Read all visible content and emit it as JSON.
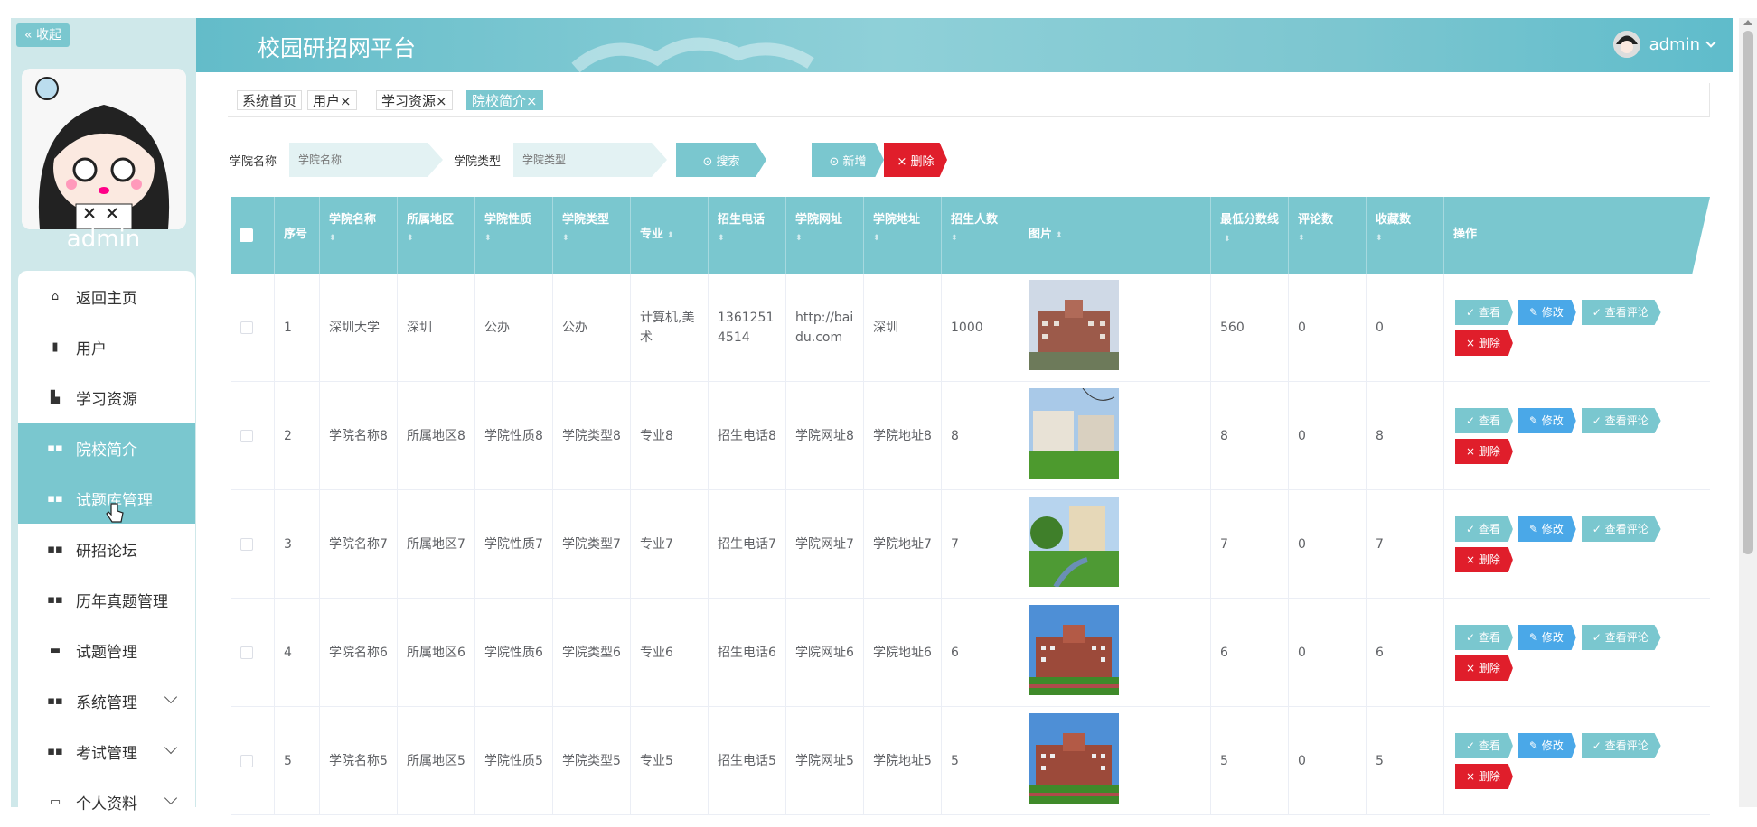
{
  "sidebar": {
    "collapse_label": "« 收起",
    "username": "admin",
    "items": [
      {
        "label": "返回主页",
        "icon": "home-icon"
      },
      {
        "label": "用户",
        "icon": "user-icon"
      },
      {
        "label": "学习资源",
        "icon": "book-icon"
      },
      {
        "label": "院校简介",
        "icon": "grid-icon",
        "active": true
      },
      {
        "label": "试题库管理",
        "icon": "grid-icon",
        "hover": true
      },
      {
        "label": "研招论坛",
        "icon": "grid-icon"
      },
      {
        "label": "历年真题管理",
        "icon": "grid-icon"
      },
      {
        "label": "试题管理",
        "icon": "file-icon"
      },
      {
        "label": "系统管理",
        "icon": "grid-icon",
        "expandable": true
      },
      {
        "label": "考试管理",
        "icon": "grid-icon",
        "expandable": true
      },
      {
        "label": "个人资料",
        "icon": "profile-icon",
        "expandable": true
      }
    ]
  },
  "header": {
    "title": "校园研招网平台",
    "user": "admin"
  },
  "tabs": [
    {
      "label": "系统首页"
    },
    {
      "label": "用户×"
    },
    {
      "label": "学习资源×"
    },
    {
      "label": "院校简介×",
      "active": true
    }
  ],
  "search": {
    "college_name_label": "学院名称",
    "college_name_placeholder": "学院名称",
    "college_type_label": "学院类型",
    "college_type_placeholder": "学院类型",
    "search_btn": "⊙ 搜索",
    "add_btn": "⊙ 新增",
    "delete_btn": "× 删除"
  },
  "table": {
    "columns": [
      "序号",
      "学院名称",
      "所属地区",
      "学院性质",
      "学院类型",
      "专业",
      "招生电话",
      "学院网址",
      "学院地址",
      "招生人数",
      "图片",
      "最低分数线",
      "评论数",
      "收藏数",
      "操作"
    ],
    "rows": [
      {
        "no": "1",
        "name": "深圳大学",
        "region": "深圳",
        "nature": "公办",
        "type": "公办",
        "major": "计算机,美术",
        "phone": "13612514514",
        "url": "http://baidu.com",
        "addr": "深圳",
        "count": "1000",
        "score": "560",
        "comments": "0",
        "favs": "0",
        "img": "building"
      },
      {
        "no": "2",
        "name": "学院名称8",
        "region": "所属地区8",
        "nature": "学院性质8",
        "type": "学院类型8",
        "major": "专业8",
        "phone": "招生电话8",
        "url": "学院网址8",
        "addr": "学院地址8",
        "count": "8",
        "score": "8",
        "comments": "0",
        "favs": "8",
        "img": "campus"
      },
      {
        "no": "3",
        "name": "学院名称7",
        "region": "所属地区7",
        "nature": "学院性质7",
        "type": "学院类型7",
        "major": "专业7",
        "phone": "招生电话7",
        "url": "学院网址7",
        "addr": "学院地址7",
        "count": "7",
        "score": "7",
        "comments": "0",
        "favs": "7",
        "img": "garden"
      },
      {
        "no": "4",
        "name": "学院名称6",
        "region": "所属地区6",
        "nature": "学院性质6",
        "type": "学院类型6",
        "major": "专业6",
        "phone": "招生电话6",
        "url": "学院网址6",
        "addr": "学院地址6",
        "count": "6",
        "score": "6",
        "comments": "0",
        "favs": "6",
        "img": "brick"
      },
      {
        "no": "5",
        "name": "学院名称5",
        "region": "所属地区5",
        "nature": "学院性质5",
        "type": "学院类型5",
        "major": "专业5",
        "phone": "招生电话5",
        "url": "学院网址5",
        "addr": "学院地址5",
        "count": "5",
        "score": "5",
        "comments": "0",
        "favs": "5",
        "img": "brick"
      }
    ],
    "ops": {
      "view": "✓ 查看",
      "edit": "✎ 修改",
      "comment": "✓ 查看评论",
      "del": "× 删除"
    }
  },
  "colors": {
    "accent": "#7ac7cf",
    "danger": "#e01e2b",
    "edit": "#4aa8e8"
  }
}
